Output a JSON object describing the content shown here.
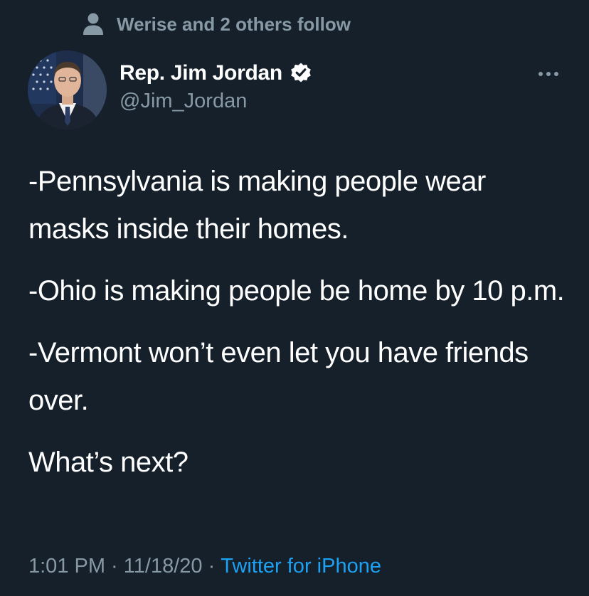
{
  "social_context": {
    "icon": "person-icon",
    "text": "Werise and 2 others follow"
  },
  "author": {
    "avatar_icon": "avatar",
    "display_name": "Rep. Jim Jordan",
    "verified_icon": "verified-badge-icon",
    "handle": "@Jim_Jordan"
  },
  "more_icon": "more-horizontal-icon",
  "tweet": {
    "paragraphs": [
      "-Pennsylvania is making people wear masks inside their homes.",
      "-Ohio is making people be home by 10 p.m.",
      "-Vermont won’t even let you have friends over.",
      "What’s next?"
    ]
  },
  "meta": {
    "time": "1:01 PM",
    "separator": " · ",
    "date": "11/18/20",
    "source": "Twitter for iPhone"
  },
  "colors": {
    "background": "#15202b",
    "text": "#ffffff",
    "secondary": "#8899a6",
    "accent": "#1da1f2"
  }
}
